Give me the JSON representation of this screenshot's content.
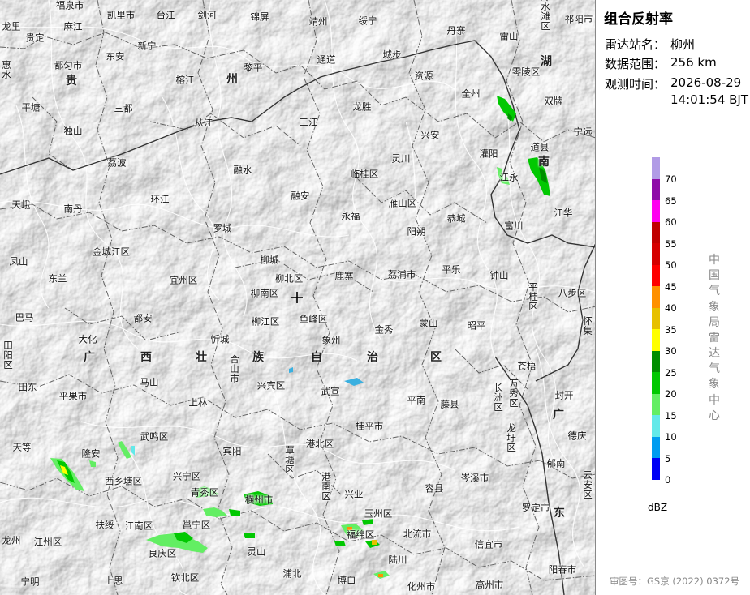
{
  "info": {
    "title": "组合反射率",
    "station_label": "雷达站名：",
    "station_value": "柳州",
    "range_label": "数据范围：",
    "range_value": "256 km",
    "time_label": "观测时间：",
    "time_date": "2026-08-29",
    "time_clock": "14:01:54 BJT"
  },
  "legend": {
    "unit": "dBZ",
    "ticks": [
      "70",
      "65",
      "60",
      "55",
      "50",
      "45",
      "40",
      "35",
      "30",
      "25",
      "20",
      "15",
      "10",
      "5",
      "0"
    ],
    "colors": [
      "#b19be6",
      "#8e0ba8",
      "#ff00f0",
      "#c00000",
      "#d60000",
      "#ff0000",
      "#ff9000",
      "#e7c000",
      "#ffff00",
      "#008e00",
      "#01c801",
      "#63ee63",
      "#63e9e9",
      "#009cf0",
      "#0000f5"
    ],
    "org": "中国气象局雷达气象中心"
  },
  "review_number": "审图号：GS京 (2022) 0372号",
  "map": {
    "places": [
      "福泉市",
      "凯里市",
      "台江",
      "剑河",
      "锦屏",
      "靖州",
      "绥宁",
      "冷水滩区",
      "祁阳市",
      "龙里",
      "麻江",
      "贵定",
      "丹寨",
      "雷山",
      "新宁",
      "东安",
      "都匀市",
      "惠水",
      "通道",
      "城步",
      "零陵区",
      "黎平",
      "榕江",
      "资源",
      "全州",
      "双牌",
      "平塘",
      "三都",
      "从江",
      "三江",
      "龙胜",
      "宁远",
      "独山",
      "兴安",
      "荔波",
      "灵川",
      "灌阳",
      "道县",
      "融水",
      "临桂区",
      "江永",
      "天峨",
      "环江",
      "融安",
      "雁山区",
      "永福",
      "富川",
      "江华",
      "南丹",
      "罗城",
      "阳朔",
      "恭城",
      "金城江区",
      "柳城",
      "凤山",
      "东兰",
      "宜州区",
      "柳北区",
      "鹿寨",
      "荔浦市",
      "平乐",
      "钟山",
      "柳南区",
      "八步区",
      "巴马",
      "都安",
      "柳江区",
      "鱼峰区",
      "大化",
      "忻城",
      "象州",
      "金秀",
      "蒙山",
      "昭平",
      "兴宾区",
      "武宣",
      "苍梧",
      "田东",
      "马山",
      "平果市",
      "上林",
      "平南",
      "藤县",
      "封开",
      "桂平市",
      "德庆",
      "天等",
      "武鸣区",
      "宾阳",
      "港北区",
      "郁南",
      "隆安",
      "兴宁区",
      "西乡塘区",
      "青秀区",
      "横州市",
      "兴业",
      "容县",
      "岑溪市",
      "罗定市",
      "扶绥",
      "邕宁区",
      "江南区",
      "玉州区",
      "北流市",
      "龙州",
      "江州区",
      "良庆区",
      "福绵区",
      "灵山",
      "信宜市",
      "陆川",
      "阳春市",
      "宁明",
      "上思",
      "钦北区",
      "浦北",
      "博白",
      "化州市",
      "高州市",
      "万秀区",
      "长洲区",
      "龙圩区",
      "平桂区",
      "覃塘区",
      "港南区",
      "合山市",
      "田阳区",
      "怀集",
      "云安区"
    ],
    "regions": [
      "贵",
      "州",
      "湖",
      "南",
      "广",
      "西",
      "壮",
      "族",
      "自",
      "治",
      "区",
      "广",
      "东"
    ],
    "radar_site": "radar-station-marker"
  }
}
